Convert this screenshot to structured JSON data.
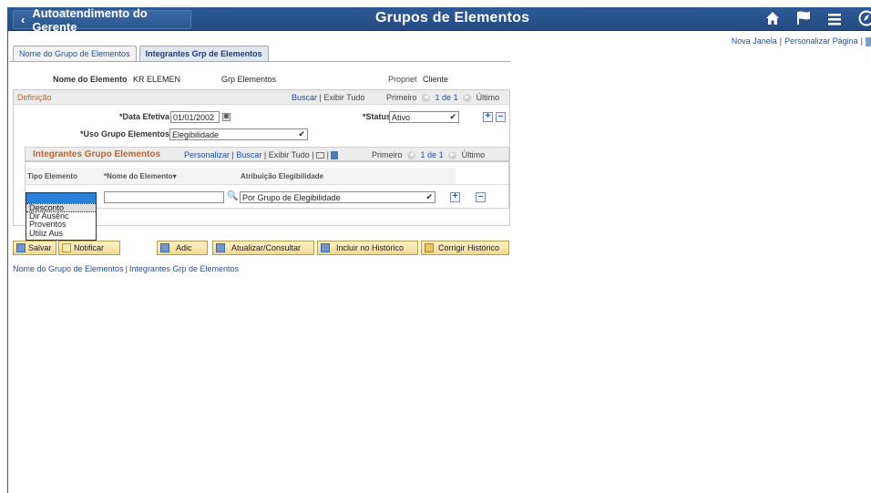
{
  "banner": {
    "back_label": "Autoatendimento do Gerente",
    "title": "Grupos de Elementos",
    "icons": [
      "home-icon",
      "flag-icon",
      "menu-icon",
      "navbar-icon"
    ]
  },
  "top_links": {
    "new_window": "Nova Janela",
    "personalize": "Personalizar Página"
  },
  "tabs": [
    {
      "label": "Nome do Grupo de Elementos",
      "active": false
    },
    {
      "label": "Integrantes Grp de Elementos",
      "active": true
    }
  ],
  "header": {
    "element_name_label": "Nome do Elemento",
    "element_name_value": "KR ELEMEN",
    "group_label": "Grp Elementos",
    "owner_label": "Propriet",
    "owner_value": "Cliente"
  },
  "definition": {
    "title": "Definição",
    "find": "Buscar",
    "view_all": "Exibir Tudo",
    "first": "Primeiro",
    "range": "1 de 1",
    "last": "Último",
    "effdt_label": "*Data Efetiva",
    "effdt_value": "01/01/2002",
    "status_label": "*Status",
    "status_value": "Ativo",
    "use_label": "*Uso Grupo Elementos",
    "use_value": "Elegibilidade"
  },
  "grid": {
    "title": "Integrantes Grupo Elementos",
    "personalize": "Personalizar",
    "find": "Buscar",
    "view_all": "Exibir Tudo",
    "first": "Primeiro",
    "range": "1 de 1",
    "last": "Último",
    "columns": [
      "Tipo Elemento",
      "*Nome do Elemento",
      "Atribuição Elegibilidade"
    ],
    "row": {
      "element_name": "",
      "assignment": "Por Grupo de Elegibilidade"
    }
  },
  "dropdown_options": [
    "Desconto",
    "Dir Ausênc",
    "Proventos",
    "Utiliz Aus"
  ],
  "toolbar": {
    "save": "Salvar",
    "notify": "Notificar",
    "add": "Adic",
    "update": "Atualizar/Consultar",
    "history": "Incluir no Histórico",
    "correct": "Corrigir Histórico"
  },
  "bottom_links": [
    "Nome do Grupo de Elementos",
    "Integrantes Grp de Elementos"
  ]
}
